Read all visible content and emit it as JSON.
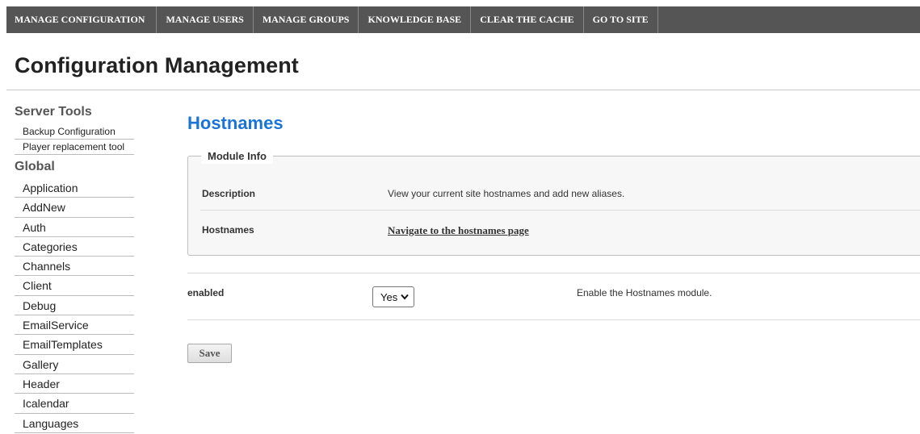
{
  "nav": {
    "items": [
      "MANAGE CONFIGURATION",
      "MANAGE USERS",
      "MANAGE GROUPS",
      "KNOWLEDGE BASE",
      "CLEAR THE CACHE",
      "GO TO SITE"
    ]
  },
  "page": {
    "title": "Configuration Management"
  },
  "sidebar": {
    "server_heading": "Server Tools",
    "server_items": [
      "Backup Configuration",
      "Player replacement tool"
    ],
    "global_heading": "Global",
    "global_items": [
      "Application",
      "AddNew",
      "Auth",
      "Categories",
      "Channels",
      "Client",
      "Debug",
      "EmailService",
      "EmailTemplates",
      "Gallery",
      "Header",
      "Icalendar",
      "Languages"
    ]
  },
  "main": {
    "module_title": "Hostnames",
    "module_info": {
      "legend": "Module Info",
      "description_label": "Description",
      "description_value": "View your current site hostnames and add new aliases.",
      "hostnames_label": "Hostnames",
      "hostnames_link": "Navigate to the hostnames page"
    },
    "setting": {
      "label": "enabled",
      "selected": "Yes",
      "description": "Enable the Hostnames module."
    },
    "save_label": "Save"
  }
}
